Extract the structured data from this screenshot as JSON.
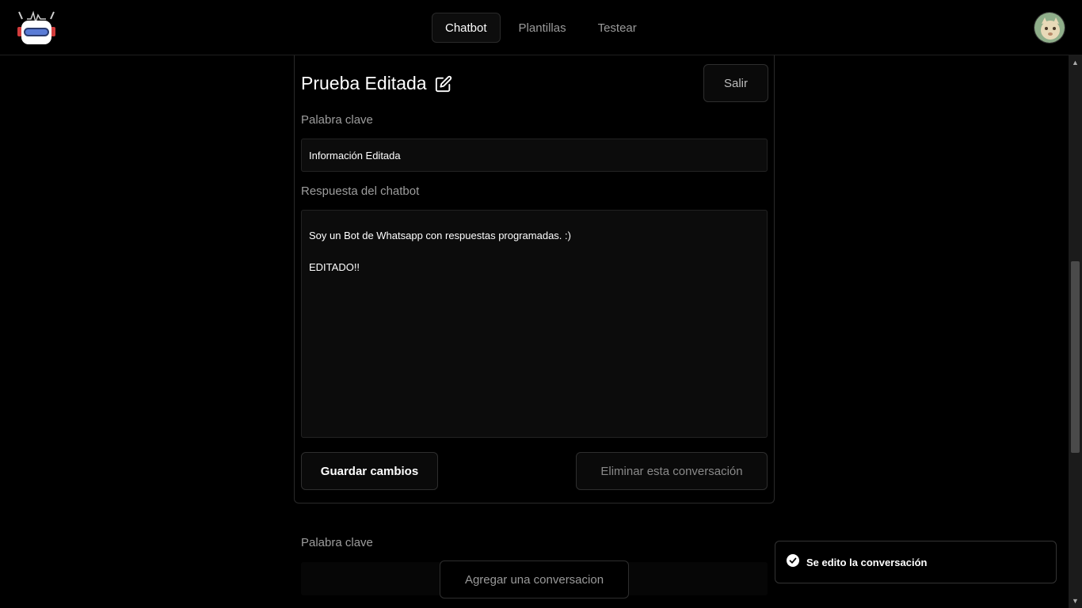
{
  "nav": {
    "tabs": [
      {
        "label": "Chatbot",
        "active": true
      },
      {
        "label": "Plantillas",
        "active": false
      },
      {
        "label": "Testear",
        "active": false
      }
    ]
  },
  "editor": {
    "title": "Prueba Editada",
    "exit_label": "Salir",
    "keyword_label": "Palabra clave",
    "keyword_value": "Información Editada",
    "response_label": "Respuesta del chatbot",
    "response_value": "Soy un Bot de Whatsapp con respuestas programadas. :)\n\nEDITADO!!",
    "save_label": "Guardar cambios",
    "delete_label": "Eliminar esta conversación"
  },
  "next_item": {
    "keyword_label": "Palabra clave"
  },
  "add_label": "Agregar una conversacion",
  "toast": {
    "message": "Se edito la conversación",
    "icon": "check-circle-icon"
  },
  "colors": {
    "background": "#000000",
    "border": "#2a2a2a",
    "input_bg": "#0c0c0c"
  }
}
